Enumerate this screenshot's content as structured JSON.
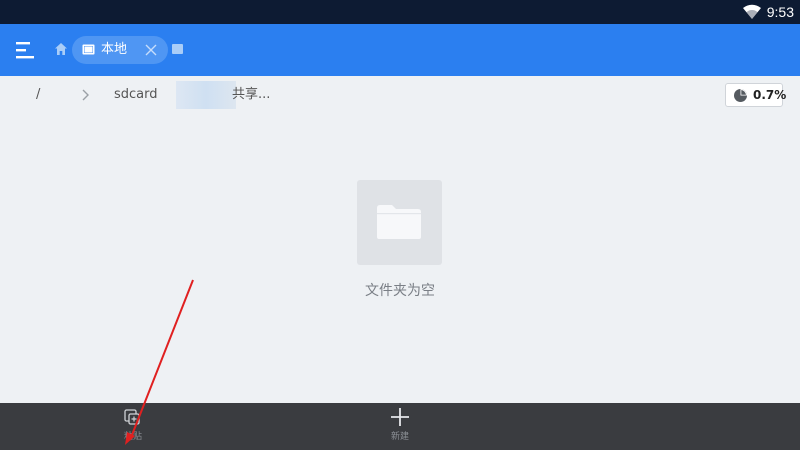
{
  "status_bar": {
    "time": "9:53",
    "wifi_icon": "wifi-icon"
  },
  "toolbar": {
    "menu_icon": "hamburger-menu-icon",
    "home_icon": "home-icon",
    "tab_label": "本地",
    "tab_icon": "tablet-icon",
    "tab_close_icon": "close-icon",
    "next_tab_icon": "tablet-icon",
    "color": "#2b7ff0"
  },
  "breadcrumb": {
    "root": "/",
    "chevron_icon": "chevron-right-icon",
    "sdcard": "sdcard",
    "share": "共享..."
  },
  "storage": {
    "percent": "0.7%",
    "pie_icon": "pie-chart-icon"
  },
  "empty_state": {
    "icon": "folder-icon",
    "text": "文件夹为空"
  },
  "bottom_bar": {
    "paste_label": "粘贴",
    "paste_icon": "paste-icon",
    "new_label": "新建",
    "new_icon": "plus-icon"
  },
  "annotation": {
    "color": "#e02020",
    "icon": "red-arrow-annotation"
  }
}
